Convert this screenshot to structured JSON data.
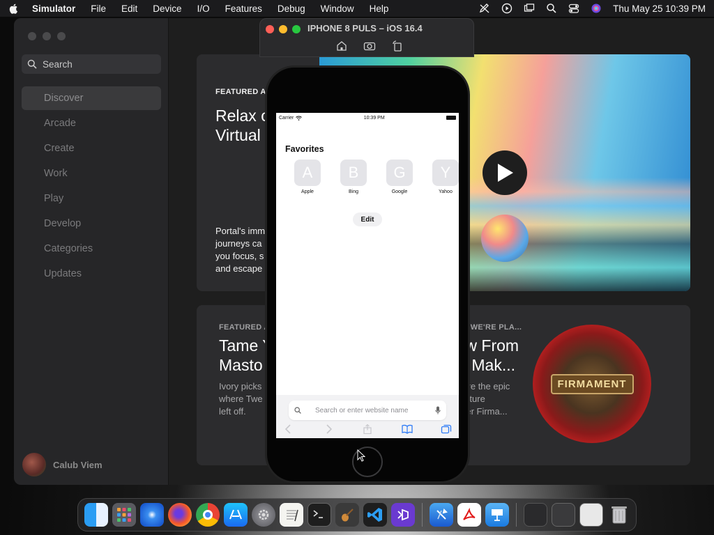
{
  "menubar": {
    "app": "Simulator",
    "items": [
      "File",
      "Edit",
      "Device",
      "I/O",
      "Features",
      "Debug",
      "Window",
      "Help"
    ],
    "datetime": "Thu May 25  10:39 PM"
  },
  "appstore": {
    "search_placeholder": "Search",
    "nav": [
      "Discover",
      "Arcade",
      "Create",
      "Work",
      "Play",
      "Develop",
      "Categories",
      "Updates"
    ],
    "active_nav": "Discover",
    "user_name": "Calub Viem",
    "card1": {
      "kicker": "FEATURED A",
      "title": "Relax o\nVirtual",
      "desc": "Portal's imm\njourneys ca\nyou focus, s\nand escape"
    },
    "card2": {
      "kicker": "FEATURED A",
      "title": "Tame Y\nMasto",
      "desc": "Ivory picks\nwhere Twe\nleft off."
    },
    "card3": {
      "kicker": "WHAT WE'RE PLA...",
      "title": "New From\nthe Mak...",
      "desc": "Explore the epic\nadventure\npuzzler Firma...",
      "art_text": "FIRMAMENT"
    }
  },
  "simulator": {
    "title": "IPHONE 8 PULS – iOS 16.4"
  },
  "phone": {
    "carrier": "Carrier",
    "time": "10:39 PM",
    "favorites_title": "Favorites",
    "favorites": [
      {
        "letter": "A",
        "label": "Apple"
      },
      {
        "letter": "B",
        "label": "Bing"
      },
      {
        "letter": "G",
        "label": "Google"
      },
      {
        "letter": "Y",
        "label": "Yahoo"
      }
    ],
    "edit_label": "Edit",
    "url_placeholder": "Search or enter website name"
  },
  "dock": {
    "apps": [
      "finder-icon",
      "launchpad-icon",
      "safari-icon",
      "firefox-icon",
      "chrome-icon",
      "app-store-icon",
      "system-settings-icon",
      "textedit-icon",
      "terminal-icon",
      "instruments-icon",
      "vscode-icon",
      "visual-studio-icon",
      "xcode-icon",
      "acrobat-icon",
      "keynote-icon",
      "window-thumb-1",
      "window-thumb-2",
      "window-thumb-3",
      "trash-icon"
    ]
  }
}
